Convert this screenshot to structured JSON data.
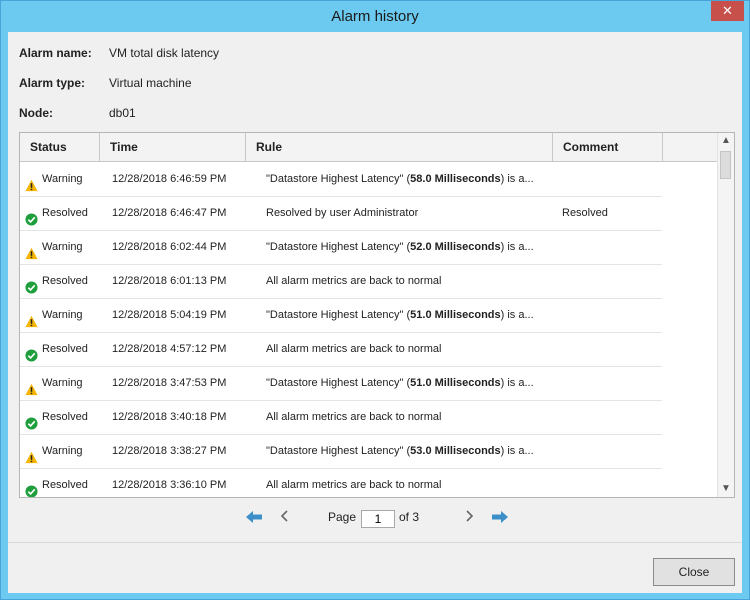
{
  "window": {
    "title": "Alarm history",
    "close_glyph": "✕"
  },
  "info": {
    "alarm_name_label": "Alarm name:",
    "alarm_name": "VM total disk latency",
    "alarm_type_label": "Alarm type:",
    "alarm_type": "Virtual machine",
    "node_label": "Node:",
    "node": "db01"
  },
  "table": {
    "headers": {
      "status": "Status",
      "time": "Time",
      "rule": "Rule",
      "comment": "Comment"
    },
    "rows": [
      {
        "status": "Warning",
        "icon": "warning-icon",
        "time": "12/28/2018 6:46:59 PM",
        "rule_pre": "\"Datastore Highest Latency\" (",
        "rule_bold": "58.0 Milliseconds",
        "rule_post": ") is a...",
        "comment": ""
      },
      {
        "status": "Resolved",
        "icon": "resolved-icon",
        "time": "12/28/2018 6:46:47 PM",
        "rule_pre": "Resolved by user Administrator",
        "rule_bold": "",
        "rule_post": "",
        "comment": "Resolved"
      },
      {
        "status": "Warning",
        "icon": "warning-icon",
        "time": "12/28/2018 6:02:44 PM",
        "rule_pre": "\"Datastore Highest Latency\" (",
        "rule_bold": "52.0 Milliseconds",
        "rule_post": ") is a...",
        "comment": ""
      },
      {
        "status": "Resolved",
        "icon": "resolved-icon",
        "time": "12/28/2018 6:01:13 PM",
        "rule_pre": "All alarm metrics are back to normal",
        "rule_bold": "",
        "rule_post": "",
        "comment": ""
      },
      {
        "status": "Warning",
        "icon": "warning-icon",
        "time": "12/28/2018 5:04:19 PM",
        "rule_pre": "\"Datastore Highest Latency\" (",
        "rule_bold": "51.0 Milliseconds",
        "rule_post": ") is a...",
        "comment": ""
      },
      {
        "status": "Resolved",
        "icon": "resolved-icon",
        "time": "12/28/2018 4:57:12 PM",
        "rule_pre": "All alarm metrics are back to normal",
        "rule_bold": "",
        "rule_post": "",
        "comment": ""
      },
      {
        "status": "Warning",
        "icon": "warning-icon",
        "time": "12/28/2018 3:47:53 PM",
        "rule_pre": "\"Datastore Highest Latency\" (",
        "rule_bold": "51.0 Milliseconds",
        "rule_post": ") is a...",
        "comment": ""
      },
      {
        "status": "Resolved",
        "icon": "resolved-icon",
        "time": "12/28/2018 3:40:18 PM",
        "rule_pre": "All alarm metrics are back to normal",
        "rule_bold": "",
        "rule_post": "",
        "comment": ""
      },
      {
        "status": "Warning",
        "icon": "warning-icon",
        "time": "12/28/2018 3:38:27 PM",
        "rule_pre": "\"Datastore Highest Latency\" (",
        "rule_bold": "53.0 Milliseconds",
        "rule_post": ") is a...",
        "comment": ""
      },
      {
        "status": "Resolved",
        "icon": "resolved-icon",
        "time": "12/28/2018 3:36:10 PM",
        "rule_pre": "All alarm metrics are back to normal",
        "rule_bold": "",
        "rule_post": "",
        "comment": ""
      }
    ]
  },
  "pager": {
    "page_label": "Page",
    "current_page": "1",
    "of_label": "of 3"
  },
  "footer": {
    "close_label": "Close"
  },
  "colors": {
    "titlebar": "#6ccaf0",
    "close_x": "#c7504a",
    "nav_arrow": "#3d8fc9",
    "warning": "#f4b400",
    "resolved": "#1e9e3c"
  }
}
